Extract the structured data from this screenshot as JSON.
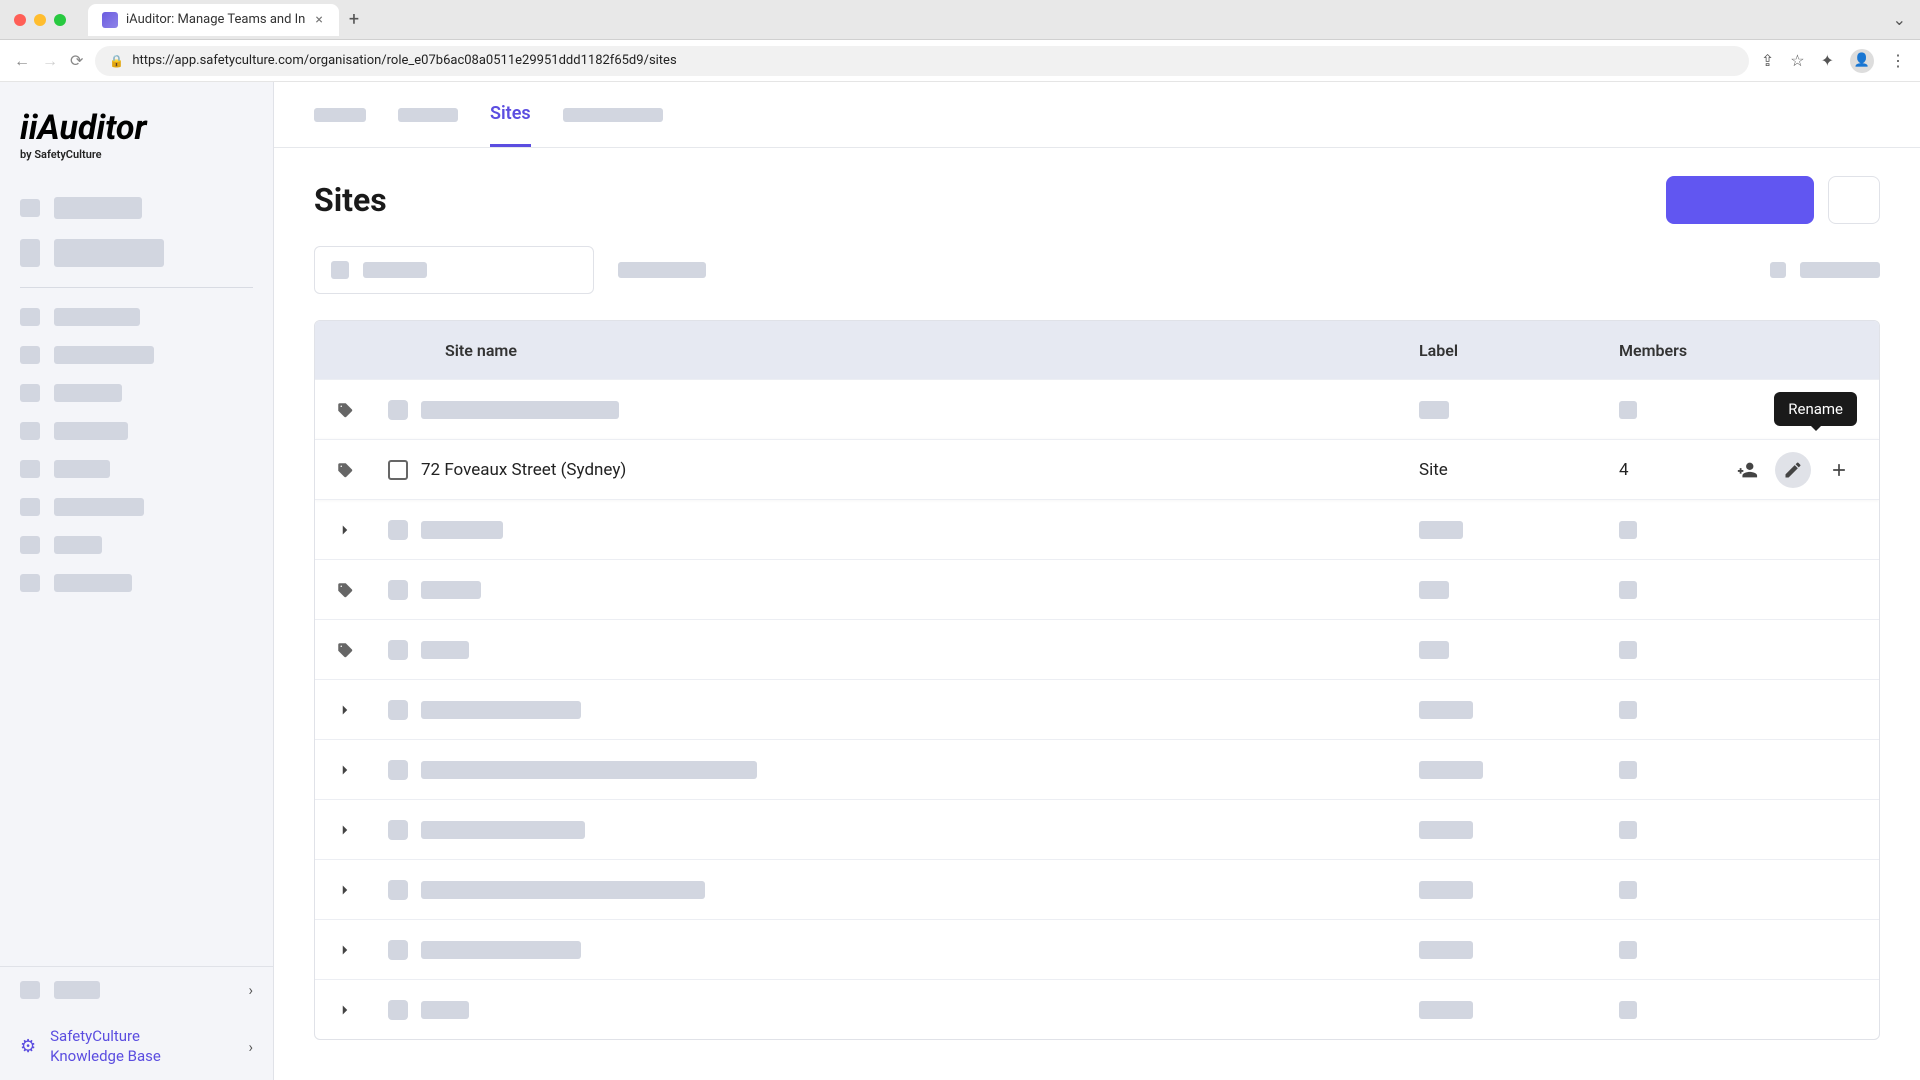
{
  "browser": {
    "tab_title": "iAuditor: Manage Teams and In",
    "url": "https://app.safetyculture.com/organisation/role_e07b6ac08a0511e29951ddd1182f65d9/sites"
  },
  "logo": {
    "brand": "iAuditor",
    "sub": "by SafetyCulture"
  },
  "sidebar": {
    "footer_kb_line1": "SafetyCulture",
    "footer_kb_line2": "Knowledge Base"
  },
  "tabs": {
    "active": "Sites"
  },
  "page": {
    "title": "Sites"
  },
  "table": {
    "headers": {
      "name": "Site name",
      "label": "Label",
      "members": "Members"
    },
    "active_row": {
      "name": "72 Foveaux Street (Sydney)",
      "label": "Site",
      "members": "4"
    },
    "tooltip": "Rename"
  },
  "icons": {
    "tag": "tag",
    "chev": "chevron-right"
  }
}
